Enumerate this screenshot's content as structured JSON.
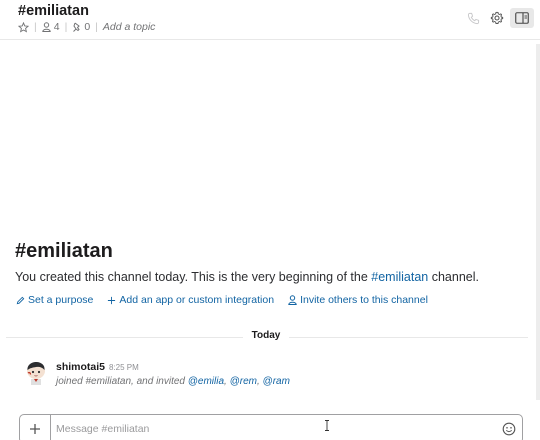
{
  "header": {
    "title": "#emiliatan",
    "members_count": "4",
    "pinned_count": "0",
    "topic_placeholder": "Add a topic",
    "icons": [
      "star-icon",
      "person-icon",
      "pin-icon",
      "call-icon",
      "gear-icon",
      "details-panel-icon"
    ]
  },
  "intro": {
    "title": "#emiliatan",
    "text_prefix": "You created this channel today. This is the very beginning of the ",
    "channel_link": "#emiliatan",
    "text_suffix": " channel.",
    "actions": {
      "purpose": "Set a purpose",
      "integration": "Add an app or custom integration",
      "invite": "Invite others to this channel"
    }
  },
  "divider": {
    "label": "Today"
  },
  "message": {
    "author": "shimotai5",
    "time": "8:25 PM",
    "text": "joined #emiliatan, and invited ",
    "mentions": [
      "@emilia",
      "@rem",
      "@ram"
    ],
    "separator": ", "
  },
  "composer": {
    "placeholder": "Message #emiliatan"
  },
  "colors": {
    "link": "#1264a3",
    "muted": "#717274",
    "border": "#a0a0a2"
  }
}
